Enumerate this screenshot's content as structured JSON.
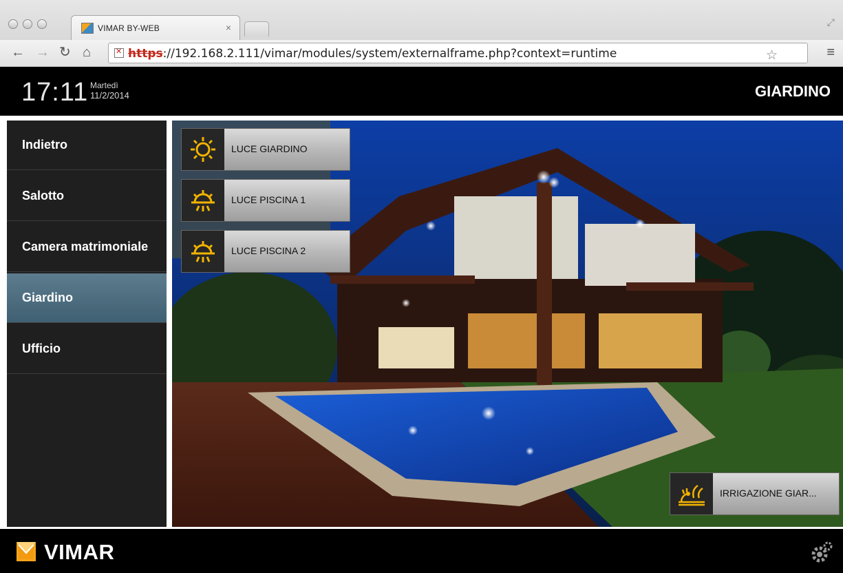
{
  "browser": {
    "tab_title": "VIMAR BY-WEB",
    "tab_close": "×",
    "url_protocol": "https",
    "url_rest": "://192.168.2.111/vimar/modules/system/externalframe.php?context=runtime"
  },
  "header": {
    "time": "17:11",
    "day": "Martedì",
    "date": "11/2/2014",
    "room_title": "GIARDINO"
  },
  "sidebar": {
    "items": [
      {
        "label": "Indietro"
      },
      {
        "label": "Salotto"
      },
      {
        "label": "Camera matrimoniale"
      },
      {
        "label": "Giardino",
        "active": true
      },
      {
        "label": "Ufficio"
      }
    ]
  },
  "controls": [
    {
      "label": "LUCE GIARDINO",
      "icon": "light-on-icon"
    },
    {
      "label": "LUCE PISCINA 1",
      "icon": "light-half-icon"
    },
    {
      "label": "LUCE PISCINA 2",
      "icon": "light-half-icon"
    },
    {
      "label": "IRRIGAZIONE GIAR...",
      "icon": "irrigation-icon"
    }
  ],
  "footer": {
    "brand": "VIMAR"
  },
  "colors": {
    "accent_yellow": "#f2b400",
    "active_item": "#4f6f82",
    "background": "#000000"
  }
}
